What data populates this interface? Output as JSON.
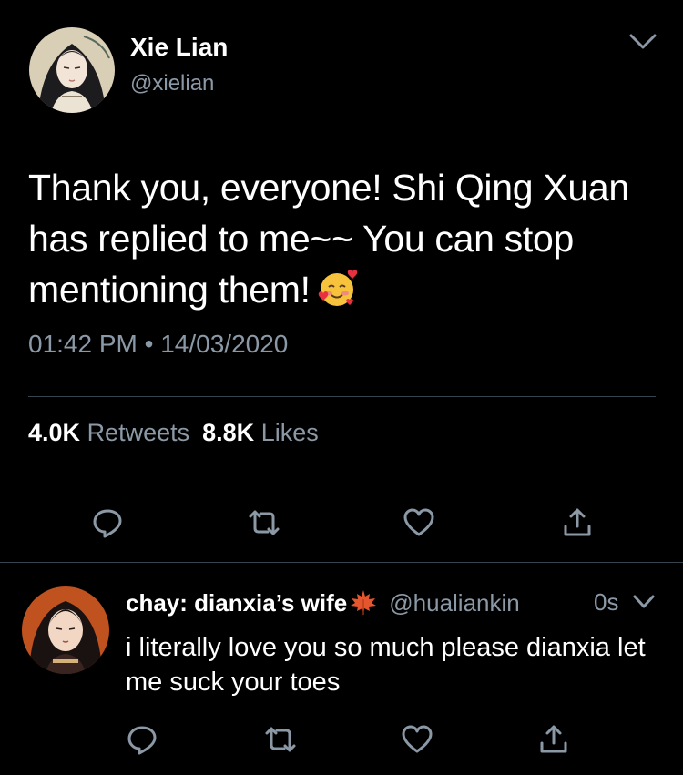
{
  "tweet": {
    "display_name": "Xie Lian",
    "handle": "@xielian",
    "text": "Thank you, everyone! Shi Qing Xuan has replied to me~~ You can stop mentioning them!",
    "emoji": "smiling-face-with-hearts",
    "time": "01:42 PM",
    "separator": "•",
    "date": "14/03/2020",
    "retweets_count": "4.0K",
    "retweets_label": "Retweets",
    "likes_count": "8.8K",
    "likes_label": "Likes"
  },
  "reply": {
    "display_name": "chay: dianxia’s wife",
    "handle": "@hualiankin",
    "time": "0s",
    "text": "i literally love you so much please dianxia let me suck your toes"
  },
  "icons": {
    "caret": "chevron-down-icon",
    "reply": "reply-bubble-icon",
    "retweet": "retweet-icon",
    "like": "heart-icon",
    "share": "share-icon",
    "leaf": "maple-leaf-icon"
  },
  "colors": {
    "background": "#000000",
    "secondary_text": "#8b98a5",
    "divider": "#38444d"
  }
}
